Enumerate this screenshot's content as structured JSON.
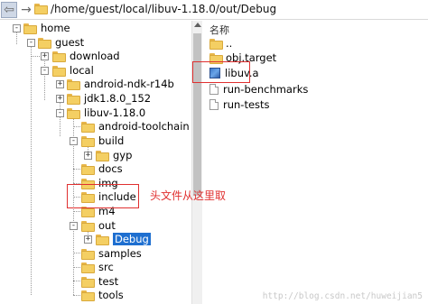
{
  "address_bar": {
    "path": "/home/guest/local/libuv-1.18.0/out/Debug",
    "back_glyph": "⇦",
    "forward_glyph": "→"
  },
  "tree": {
    "items": [
      {
        "label": "home",
        "expander": "-"
      },
      {
        "label": "guest",
        "expander": "-"
      },
      {
        "label": "download",
        "expander": "+"
      },
      {
        "label": "local",
        "expander": "-"
      },
      {
        "label": "android-ndk-r14b",
        "expander": "+"
      },
      {
        "label": "jdk1.8.0_152",
        "expander": "+"
      },
      {
        "label": "libuv-1.18.0",
        "expander": "-"
      },
      {
        "label": "android-toolchain",
        "expander": ""
      },
      {
        "label": "build",
        "expander": "-"
      },
      {
        "label": "gyp",
        "expander": "+"
      },
      {
        "label": "docs",
        "expander": ""
      },
      {
        "label": "img",
        "expander": ""
      },
      {
        "label": "include",
        "expander": ""
      },
      {
        "label": "m4",
        "expander": ""
      },
      {
        "label": "out",
        "expander": "-"
      },
      {
        "label": "Debug",
        "expander": "+",
        "selected": true
      },
      {
        "label": "samples",
        "expander": ""
      },
      {
        "label": "src",
        "expander": ""
      },
      {
        "label": "test",
        "expander": ""
      },
      {
        "label": "tools",
        "expander": ""
      }
    ]
  },
  "list": {
    "column_header": "名称",
    "items": [
      {
        "label": "..",
        "icon": "folder-icon"
      },
      {
        "label": "obj.target",
        "icon": "folder-icon"
      },
      {
        "label": "libuv.a",
        "icon": "library-file-icon"
      },
      {
        "label": "run-benchmarks",
        "icon": "file-icon"
      },
      {
        "label": "run-tests",
        "icon": "file-icon"
      }
    ]
  },
  "annotation": {
    "text": "头文件从这里取",
    "color": "#e03030"
  },
  "watermark": "http://blog.csdn.net/huweijian5",
  "colors": {
    "selection": "#1e6fd0",
    "folder": "#f4cf63",
    "highlight_box": "#e03030"
  }
}
